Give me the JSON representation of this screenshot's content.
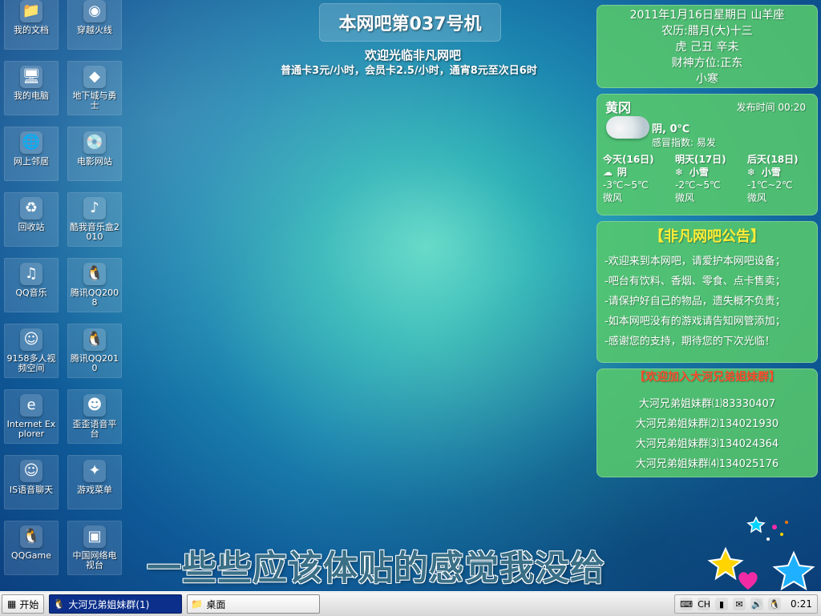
{
  "colors": {
    "panel_green": "#56c86c",
    "notice_title": "#ffee37",
    "group_title": "#ff4a2b",
    "taskbar_active": "#0b2f8a"
  },
  "desktop_icons": [
    {
      "label": "我的文档",
      "icon": "folder-icon",
      "glyph": "📁"
    },
    {
      "label": "穿越火线",
      "icon": "cf-game-icon",
      "glyph": "◉"
    },
    {
      "label": "我的电脑",
      "icon": "computer-icon",
      "glyph": "🖥"
    },
    {
      "label": "地下城与勇士",
      "icon": "dnf-game-icon",
      "glyph": "◆"
    },
    {
      "label": "网上邻居",
      "icon": "network-icon",
      "glyph": "🌐"
    },
    {
      "label": "电影网站",
      "icon": "dvd-icon",
      "glyph": "💿"
    },
    {
      "label": "回收站",
      "icon": "recycle-bin-icon",
      "glyph": "♻"
    },
    {
      "label": "酷我音乐盒2010",
      "icon": "music-box-icon",
      "glyph": "♪"
    },
    {
      "label": "QQ音乐",
      "icon": "qq-music-icon",
      "glyph": "♫"
    },
    {
      "label": "腾讯QQ2008",
      "icon": "qq-penguin-icon",
      "glyph": "🐧"
    },
    {
      "label": "9158多人视频空间",
      "icon": "video-chat-icon",
      "glyph": "☺"
    },
    {
      "label": "腾讯QQ2010",
      "icon": "qq-penguin-icon",
      "glyph": "🐧"
    },
    {
      "label": "Internet Explorer",
      "icon": "internet-explorer-icon",
      "glyph": "e"
    },
    {
      "label": "歪歪语音平台",
      "icon": "yy-voice-icon",
      "glyph": "☻"
    },
    {
      "label": "IS语音聊天",
      "icon": "voice-chat-icon",
      "glyph": "☺"
    },
    {
      "label": "游戏菜单",
      "icon": "game-menu-icon",
      "glyph": "✦"
    },
    {
      "label": "QQGame",
      "icon": "qq-game-icon",
      "glyph": "🐧"
    },
    {
      "label": "中国网络电视台",
      "icon": "tv-icon",
      "glyph": "▣"
    }
  ],
  "header": {
    "machine_title": "本网吧第037号机",
    "welcome": "欢迎光临非凡网吧",
    "pricing": "普通卡3元/小时，会员卡2.5/小时，通宵8元至次日6时"
  },
  "calendar": {
    "lines": [
      "2011年1月16日星期日 山羊座",
      "农历:腊月(大)十三",
      "虎 己丑 辛未",
      "财神方位:正东",
      "小寒"
    ]
  },
  "weather": {
    "city": "黄冈",
    "publish": "发布时间 00:20",
    "now": "阴, 0℃",
    "cold_index": "感冒指数: 易发",
    "forecast": [
      {
        "day": "今天(16日)",
        "icon": "overcast-icon",
        "glyph": "☁",
        "cond": "阴",
        "temp": "-3℃~5℃",
        "wind": "微风"
      },
      {
        "day": "明天(17日)",
        "icon": "light-snow-icon",
        "glyph": "❄",
        "cond": "小雪",
        "temp": "-2℃~5℃",
        "wind": "微风"
      },
      {
        "day": "后天(18日)",
        "icon": "light-snow-icon",
        "glyph": "❄",
        "cond": "小雪",
        "temp": "-1℃~2℃",
        "wind": "微风"
      }
    ]
  },
  "notice": {
    "title": "【非凡网吧公告】",
    "items": [
      "-欢迎来到本网吧，请爱护本网吧设备；",
      "-吧台有饮料、香烟、零食、点卡售卖；",
      "-请保护好自己的物品，遗失概不负责；",
      "-如本网吧没有的游戏请告知网管添加；",
      "-感谢您的支持，期待您的下次光临！"
    ]
  },
  "groups": {
    "title": "【欢迎加入大河兄弟姐妹群】",
    "items": [
      "大河兄弟姐妹群⑴83330407",
      "大河兄弟姐妹群⑵134021930",
      "大河兄弟姐妹群⑶134024364",
      "大河兄弟姐妹群⑷134025176"
    ]
  },
  "banner": {
    "lyric": "一些些应该体贴的感觉我没给"
  },
  "taskbar": {
    "start_label": "开始",
    "buttons": [
      {
        "label": "大河兄弟姐妹群(1)",
        "icon": "qq-chat-icon",
        "glyph": "🐧",
        "active": true
      },
      {
        "label": "桌面",
        "icon": "folder-icon",
        "glyph": "📁",
        "active": false
      }
    ],
    "tray": {
      "ime": "CH",
      "time": "0:21"
    }
  }
}
